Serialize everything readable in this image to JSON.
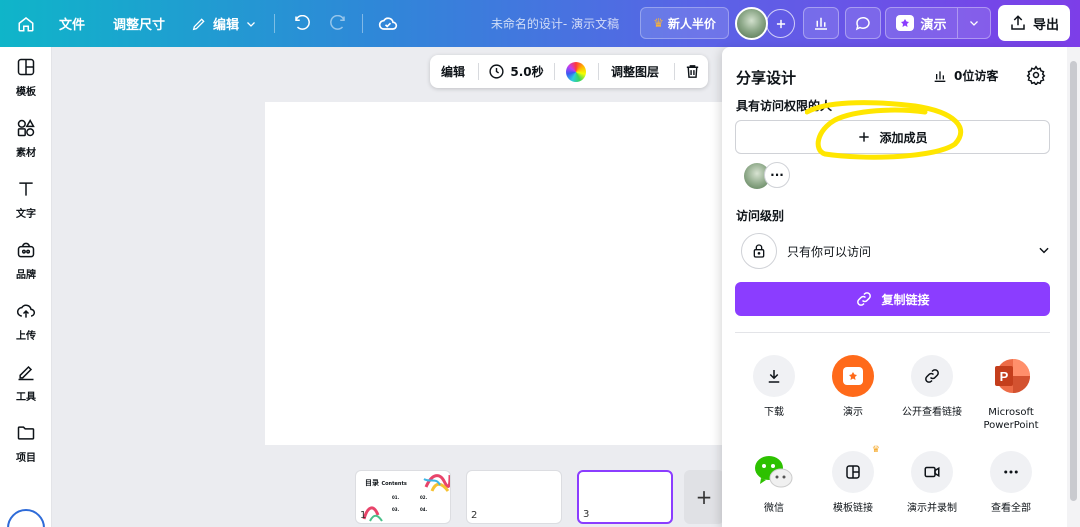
{
  "topbar": {
    "file": "文件",
    "resize": "调整尺寸",
    "edit": "编辑",
    "doc_title": "未命名的设计- 演示文稿",
    "promo": "新人半价",
    "present": "演示",
    "export": "导出"
  },
  "sidebar": {
    "items": [
      {
        "label": "模板",
        "icon": "template-icon"
      },
      {
        "label": "素材",
        "icon": "elements-icon"
      },
      {
        "label": "文字",
        "icon": "text-icon"
      },
      {
        "label": "品牌",
        "icon": "brand-icon"
      },
      {
        "label": "上传",
        "icon": "upload-icon"
      },
      {
        "label": "工具",
        "icon": "draw-icon"
      },
      {
        "label": "项目",
        "icon": "folder-icon"
      }
    ]
  },
  "context_toolbar": {
    "edit": "编辑",
    "duration": "5.0秒",
    "adjust_layers": "调整图层"
  },
  "thumbnails": {
    "page1": {
      "number": "1",
      "title": "目录",
      "subtitle": "Contents",
      "items": [
        "01.",
        "02.",
        "03.",
        "04."
      ]
    },
    "page2": {
      "number": "2"
    },
    "page3": {
      "number": "3"
    },
    "add": "+"
  },
  "share": {
    "title": "分享设计",
    "visitors": "0位访客",
    "access_label": "具有访问权限的人",
    "add_member": "添加成员",
    "more": "···",
    "level_label": "访问级别",
    "level_value": "只有你可以访问",
    "copy_link": "复制链接",
    "options": [
      {
        "label": "下载",
        "icon": "download-icon"
      },
      {
        "label": "演示",
        "icon": "present-icon"
      },
      {
        "label": "公开查看链接",
        "icon": "link-icon"
      },
      {
        "label": "Microsoft PowerPoint",
        "icon": "powerpoint-icon"
      },
      {
        "label": "微信",
        "icon": "wechat-icon"
      },
      {
        "label": "模板链接",
        "icon": "template-link-icon"
      },
      {
        "label": "演示并录制",
        "icon": "record-icon"
      },
      {
        "label": "查看全部",
        "icon": "more-icon"
      }
    ]
  },
  "colors": {
    "accent": "#8b3dff",
    "highlight": "#ffe600",
    "present_orange": "#ff6a1a"
  }
}
